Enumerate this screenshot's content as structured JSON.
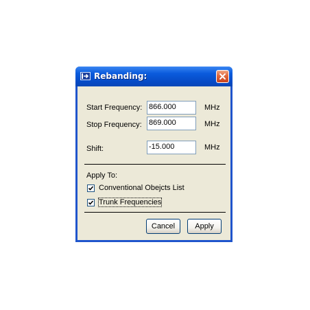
{
  "dialog": {
    "title": "Rebanding:",
    "title_icon": "arrow-into-box-icon",
    "close_icon": "close-icon"
  },
  "form": {
    "start": {
      "label": "Start Frequency:",
      "value": "866.000",
      "unit": "MHz"
    },
    "stop": {
      "label": "Stop Frequency:",
      "value": "869.000",
      "unit": "MHz"
    },
    "shift": {
      "label": "Shift:",
      "value": "-15.000",
      "unit": "MHz"
    }
  },
  "apply_to": {
    "label": "Apply To:",
    "options": [
      {
        "label": "Conventional Obejcts List",
        "checked": true
      },
      {
        "label": "Trunk Frequencies",
        "checked": true
      }
    ]
  },
  "buttons": {
    "cancel": "Cancel",
    "apply": "Apply"
  },
  "colors": {
    "title_bar": "#0a5bdc",
    "client": "#ece9d8",
    "close": "#e1673c",
    "field_border": "#7f9db9"
  }
}
